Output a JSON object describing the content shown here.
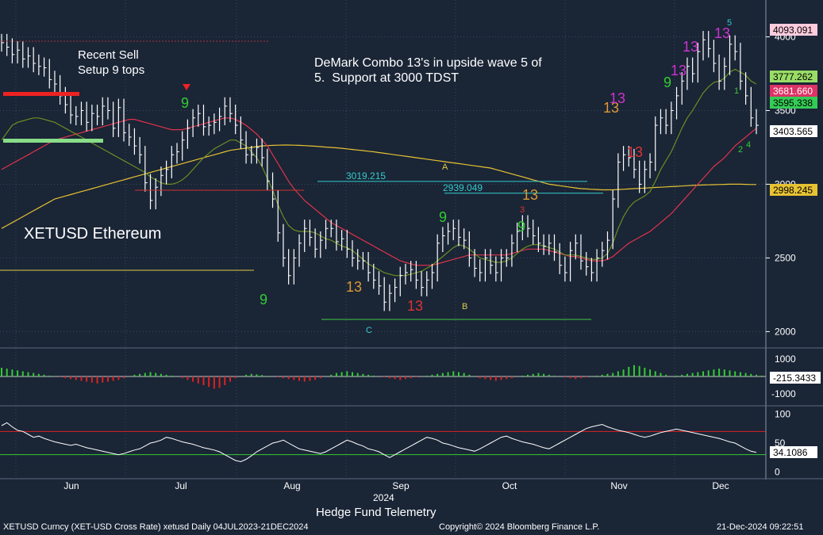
{
  "chart_data": {
    "type": "line",
    "title": "XETUSD Ethereum",
    "xlabel": "2024",
    "ylabel": "",
    "panel_main": {
      "ylim": [
        1900,
        4250
      ],
      "yticks": [
        2000,
        2500,
        3000,
        3500,
        4000
      ],
      "series": {
        "price_close": [
          3960,
          3930,
          3880,
          3910,
          3850,
          3870,
          3820,
          3800,
          3790,
          3710,
          3680,
          3600,
          3540,
          3470,
          3460,
          3500,
          3420,
          3480,
          3460,
          3530,
          3500,
          3380,
          3520,
          3350,
          3320,
          3260,
          3200,
          3010,
          2890,
          2980,
          3060,
          3100,
          3200,
          3220,
          3300,
          3380,
          3450,
          3480,
          3390,
          3400,
          3420,
          3460,
          3530,
          3480,
          3400,
          3300,
          3200,
          3200,
          3250,
          3180,
          3020,
          2900,
          2670,
          2500,
          2380,
          2500,
          2600,
          2700,
          2640,
          2560,
          2620,
          2700,
          2700,
          2610,
          2630,
          2560,
          2500,
          2480,
          2480,
          2400,
          2350,
          2310,
          2200,
          2260,
          2300,
          2380,
          2400,
          2420,
          2350,
          2300,
          2350,
          2400,
          2600,
          2650,
          2680,
          2700,
          2640,
          2620,
          2500,
          2430,
          2400,
          2500,
          2450,
          2400,
          2500,
          2500,
          2600,
          2680,
          2730,
          2700,
          2650,
          2600,
          2580,
          2600,
          2540,
          2450,
          2400,
          2550,
          2600,
          2480,
          2440,
          2400,
          2500,
          2550,
          2620,
          2900,
          3150,
          3200,
          3180,
          3100,
          3000,
          3100,
          3150,
          3400,
          3450,
          3400,
          3500,
          3600,
          3700,
          3800,
          3750,
          3900,
          3980,
          3920,
          3820,
          3700,
          3800,
          3950,
          3900,
          3700,
          3600,
          3450,
          3400
        ],
        "ma_green_short": [
          3300,
          3350,
          3400,
          3420,
          3430,
          3440,
          3450,
          3450,
          3440,
          3430,
          3420,
          3400,
          3380,
          3360,
          3340,
          3320,
          3300,
          3280,
          3260,
          3240,
          3220,
          3200,
          3180,
          3160,
          3140,
          3120,
          3100,
          3080,
          3050,
          3030,
          3010,
          3000,
          3000,
          3010,
          3030,
          3060,
          3100,
          3140,
          3180,
          3210,
          3240,
          3260,
          3280,
          3300,
          3300,
          3280,
          3260,
          3220,
          3180,
          3120,
          3040,
          2960,
          2860,
          2780,
          2720,
          2690,
          2680,
          2680,
          2680,
          2670,
          2650,
          2630,
          2620,
          2600,
          2580,
          2570,
          2550,
          2520,
          2490,
          2460,
          2440,
          2420,
          2400,
          2390,
          2380,
          2380,
          2380,
          2390,
          2400,
          2410,
          2430,
          2450,
          2480,
          2510,
          2540,
          2570,
          2590,
          2580,
          2560,
          2530,
          2500,
          2490,
          2480,
          2470,
          2470,
          2480,
          2500,
          2530,
          2560,
          2580,
          2590,
          2590,
          2580,
          2570,
          2560,
          2540,
          2520,
          2520,
          2520,
          2510,
          2500,
          2490,
          2490,
          2500,
          2530,
          2600,
          2700,
          2780,
          2840,
          2880,
          2900,
          2920,
          2950,
          3020,
          3100,
          3160,
          3220,
          3300,
          3380,
          3450,
          3500,
          3560,
          3620,
          3660,
          3690,
          3700,
          3720,
          3760,
          3780,
          3760,
          3740,
          3700,
          3680
        ],
        "ma_red_mid": [
          3100,
          3120,
          3140,
          3160,
          3180,
          3200,
          3220,
          3240,
          3260,
          3280,
          3300,
          3310,
          3320,
          3330,
          3340,
          3350,
          3360,
          3370,
          3380,
          3390,
          3400,
          3410,
          3420,
          3430,
          3440,
          3440,
          3430,
          3420,
          3410,
          3400,
          3390,
          3380,
          3370,
          3370,
          3370,
          3380,
          3390,
          3400,
          3410,
          3420,
          3430,
          3440,
          3450,
          3450,
          3440,
          3420,
          3400,
          3370,
          3340,
          3300,
          3260,
          3200,
          3140,
          3080,
          3020,
          2970,
          2930,
          2890,
          2860,
          2830,
          2800,
          2770,
          2740,
          2720,
          2700,
          2680,
          2660,
          2640,
          2620,
          2600,
          2580,
          2560,
          2540,
          2520,
          2500,
          2480,
          2470,
          2460,
          2450,
          2450,
          2450,
          2450,
          2460,
          2470,
          2480,
          2490,
          2500,
          2510,
          2520,
          2520,
          2520,
          2520,
          2520,
          2520,
          2520,
          2520,
          2530,
          2540,
          2550,
          2560,
          2560,
          2560,
          2560,
          2550,
          2540,
          2530,
          2520,
          2510,
          2510,
          2500,
          2490,
          2480,
          2480,
          2480,
          2490,
          2510,
          2540,
          2570,
          2600,
          2620,
          2640,
          2660,
          2680,
          2710,
          2740,
          2770,
          2800,
          2840,
          2880,
          2920,
          2960,
          3000,
          3040,
          3080,
          3120,
          3150,
          3180,
          3220,
          3260,
          3290,
          3320,
          3350,
          3380
        ],
        "ma_yellow_long": [
          2700,
          2720,
          2740,
          2760,
          2780,
          2800,
          2820,
          2840,
          2860,
          2880,
          2900,
          2910,
          2920,
          2930,
          2940,
          2950,
          2960,
          2970,
          2980,
          2990,
          3000,
          3010,
          3020,
          3030,
          3040,
          3050,
          3060,
          3070,
          3080,
          3090,
          3100,
          3110,
          3120,
          3130,
          3140,
          3150,
          3160,
          3170,
          3180,
          3190,
          3200,
          3210,
          3220,
          3230,
          3235,
          3240,
          3245,
          3250,
          3255,
          3260,
          3262,
          3264,
          3265,
          3266,
          3266,
          3265,
          3264,
          3262,
          3260,
          3258,
          3255,
          3252,
          3250,
          3247,
          3244,
          3240,
          3236,
          3232,
          3228,
          3224,
          3220,
          3215,
          3210,
          3205,
          3200,
          3195,
          3190,
          3185,
          3180,
          3175,
          3170,
          3165,
          3160,
          3155,
          3150,
          3145,
          3140,
          3135,
          3130,
          3125,
          3120,
          3115,
          3110,
          3100,
          3090,
          3080,
          3070,
          3060,
          3050,
          3040,
          3030,
          3020,
          3010,
          3000,
          2995,
          2990,
          2985,
          2980,
          2975,
          2970,
          2968,
          2966,
          2964,
          2962,
          2962,
          2962,
          2964,
          2966,
          2968,
          2970,
          2972,
          2974,
          2976,
          2978,
          2980,
          2982,
          2984,
          2986,
          2988,
          2990,
          2992,
          2994,
          2995,
          2996,
          2997,
          2998,
          2999,
          3000,
          3000,
          3000,
          2999,
          2998,
          2998
        ]
      },
      "last_values": [
        "4093.091",
        "3777.262",
        "3681.660",
        "3595.338",
        "3403.565",
        "2998.245"
      ],
      "level_labels": [
        "3019.215",
        "2939.049"
      ],
      "annotations": {
        "recent_sell": "Recent Sell\nSetup 9 tops",
        "demark_note": "DeMark Combo 13's in upside wave 5 of\n5.  Support at 3000 TDST",
        "instrument": "XETUSD Ethereum"
      },
      "demark_13_labels": [
        "13",
        "13",
        "13",
        "13",
        "13",
        "13",
        "13",
        "13",
        "13"
      ],
      "demark_9_labels": [
        "9",
        "9",
        "9",
        "9",
        "9"
      ],
      "wave_labels": [
        "A",
        "B",
        "C",
        "1",
        "2",
        "3",
        "4",
        "5"
      ]
    },
    "panel_histogram": {
      "ylim": [
        -1500,
        1500
      ],
      "yticks": [
        1000,
        -1000
      ],
      "last_value": "-215.3433",
      "values": [
        500,
        450,
        400,
        350,
        300,
        250,
        200,
        150,
        100,
        50,
        0,
        -50,
        -100,
        -150,
        -200,
        -250,
        -300,
        -350,
        -400,
        -350,
        -300,
        -250,
        -200,
        -100,
        0,
        100,
        150,
        200,
        250,
        200,
        150,
        100,
        50,
        0,
        -100,
        -200,
        -300,
        -400,
        -500,
        -600,
        -700,
        -650,
        -500,
        -300,
        -100,
        0,
        100,
        150,
        120,
        80,
        40,
        0,
        -50,
        -100,
        -150,
        -200,
        -250,
        -300,
        -250,
        -200,
        -100,
        0,
        100,
        200,
        250,
        300,
        250,
        200,
        150,
        100,
        50,
        0,
        -50,
        -100,
        -150,
        -200,
        -150,
        -100,
        -50,
        0,
        50,
        100,
        150,
        200,
        250,
        300,
        250,
        200,
        100,
        0,
        -100,
        -150,
        -200,
        -250,
        -200,
        -150,
        -100,
        0,
        50,
        100,
        150,
        200,
        150,
        100,
        50,
        0,
        -50,
        -100,
        -150,
        -100,
        -50,
        0,
        50,
        100,
        150,
        200,
        300,
        400,
        550,
        650,
        600,
        500,
        400,
        300,
        200,
        100,
        0,
        50,
        100,
        150,
        200,
        250,
        300,
        350,
        400,
        450,
        400,
        350,
        300,
        250,
        200,
        150,
        100,
        50,
        0,
        -100,
        -150,
        -200,
        -215
      ]
    },
    "panel_oscillator": {
      "ylim": [
        -10,
        110
      ],
      "yticks": [
        100,
        50,
        0
      ],
      "upper_band": 70,
      "lower_band": 30,
      "last_value": "34.1086",
      "values": [
        80,
        85,
        78,
        72,
        70,
        65,
        60,
        62,
        58,
        55,
        52,
        50,
        48,
        46,
        48,
        45,
        42,
        40,
        38,
        36,
        34,
        32,
        30,
        32,
        35,
        38,
        40,
        45,
        50,
        52,
        55,
        60,
        58,
        55,
        52,
        50,
        48,
        45,
        42,
        40,
        38,
        35,
        30,
        25,
        20,
        18,
        22,
        28,
        35,
        40,
        45,
        50,
        52,
        55,
        50,
        45,
        40,
        38,
        36,
        34,
        32,
        35,
        40,
        45,
        50,
        55,
        52,
        48,
        45,
        40,
        38,
        35,
        30,
        25,
        30,
        35,
        40,
        45,
        50,
        55,
        60,
        58,
        55,
        50,
        48,
        45,
        42,
        40,
        38,
        36,
        40,
        45,
        50,
        55,
        60,
        62,
        58,
        55,
        52,
        50,
        48,
        45,
        42,
        40,
        45,
        50,
        55,
        60,
        65,
        70,
        75,
        78,
        80,
        82,
        78,
        75,
        72,
        70,
        68,
        65,
        62,
        60,
        62,
        65,
        68,
        70,
        72,
        74,
        72,
        70,
        68,
        66,
        64,
        62,
        60,
        58,
        55,
        52,
        50,
        45,
        40,
        36,
        34
      ]
    },
    "x_axis": {
      "months": [
        "Jun",
        "Jul",
        "Aug",
        "Sep",
        "Oct",
        "Nov",
        "Dec"
      ],
      "year_label": "2024"
    },
    "footer": {
      "center_title": "Hedge Fund Telemetry",
      "left": "XETUSD Curncy (XET-USD Cross Rate) xetusd  Daily 04JUL2023-21DEC2024",
      "copyright": "Copyright© 2024 Bloomberg Finance L.P.",
      "timestamp": "21-Dec-2024 09:22:51"
    },
    "colors": {
      "background": "#1a2536",
      "price": "#ffffff",
      "ma_green": "#6b8e23",
      "ma_red": "#e0334a",
      "ma_yellow": "#e6c233",
      "hist_pos": "#33cc33",
      "hist_neg": "#dd2222",
      "band_red": "#dd2222",
      "band_green": "#33cc33"
    }
  }
}
